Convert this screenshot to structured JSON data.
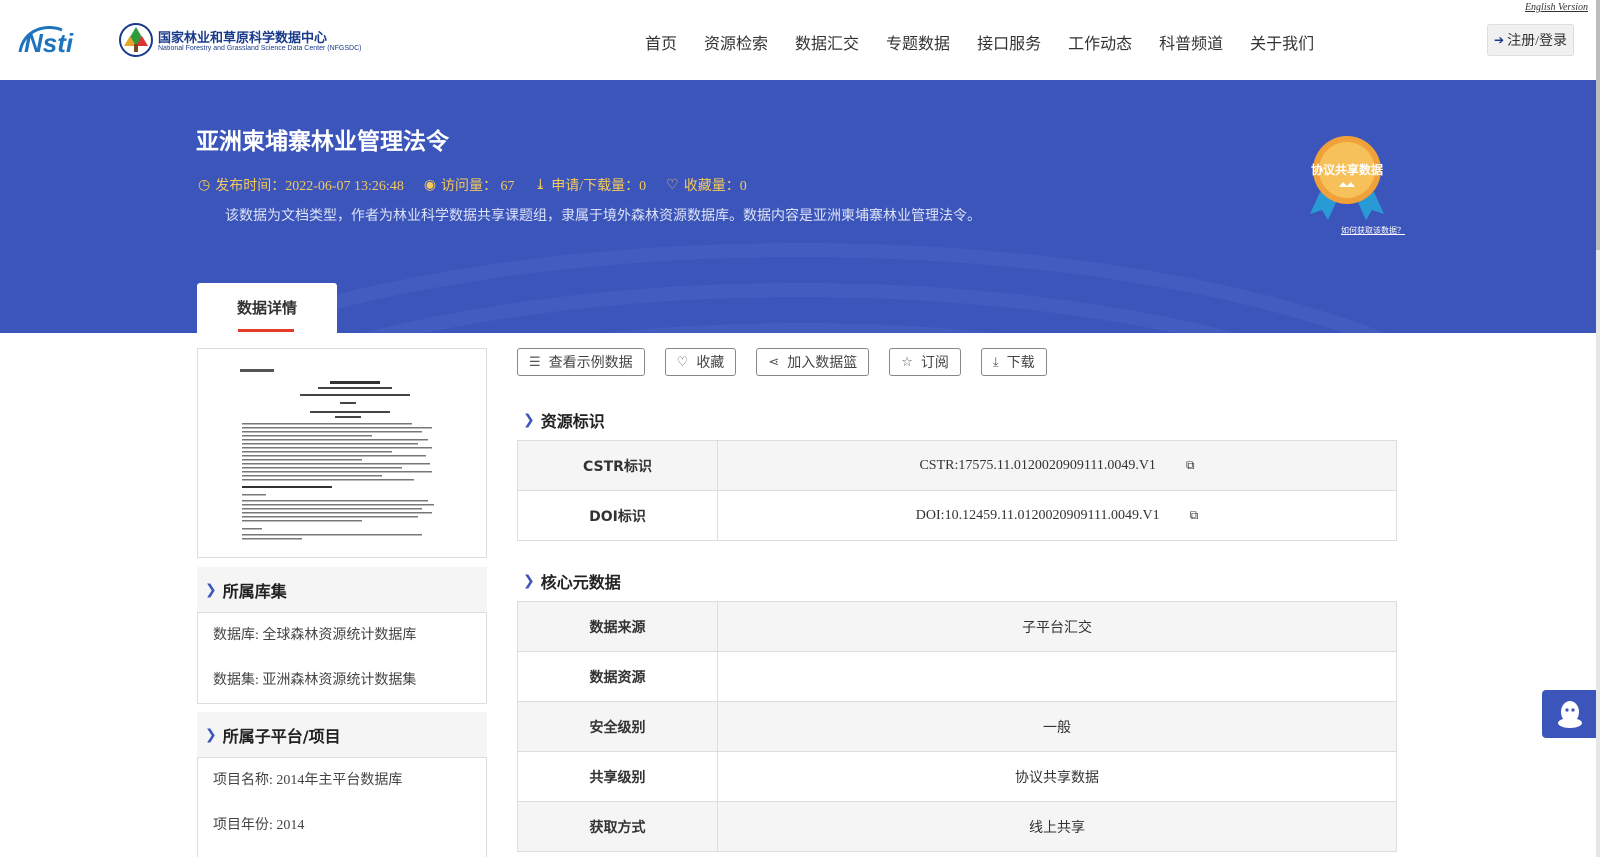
{
  "header": {
    "logo_left": "Nsti",
    "org_title": "国家林业和草原科学数据中心",
    "org_subtitle": "National Forestry and Grassland Science Data Center (NFGSDC)",
    "nav": [
      "首页",
      "资源检索",
      "数据汇交",
      "专题数据",
      "接口服务",
      "工作动态",
      "科普频道",
      "关于我们"
    ],
    "english_link": "English Version",
    "login_label": "注册/登录"
  },
  "banner": {
    "title": "亚洲柬埔寨林业管理法令",
    "meta": {
      "publish": "发布时间：2022-06-07 13:26:48",
      "views": "访问量： 67",
      "downloads": "申请/下载量：0",
      "favorites": "收藏量：0"
    },
    "description": "该数据为文档类型，作者为林业科学数据共享课题组，隶属于境外森林资源数据库。数据内容是亚洲柬埔寨林业管理法令。",
    "badge_text": "协议共享数据",
    "badge_link": "如何获取该数据？",
    "tab_label": "数据详情"
  },
  "left": {
    "collection_head": "所属库集",
    "collection_items": [
      "数据库: 全球森林资源统计数据库",
      "数据集: 亚洲森林资源统计数据集"
    ],
    "platform_head": "所属子平台/项目",
    "platform_items": [
      "项目名称: 2014年主平台数据库",
      "项目年份: 2014"
    ]
  },
  "actions": [
    "查看示例数据",
    "收藏",
    "加入数据篮",
    "订阅",
    "下载"
  ],
  "identifiers": {
    "head": "资源标识",
    "rows": [
      {
        "key": "CSTR标识",
        "value": "CSTR:17575.11.0120020909111.0049.V1"
      },
      {
        "key": "DOI标识",
        "value": "DOI:10.12459.11.0120020909111.0049.V1"
      }
    ]
  },
  "core": {
    "head": "核心元数据",
    "rows": [
      {
        "key": "数据来源",
        "value": "子平台汇交"
      },
      {
        "key": "数据资源",
        "value": ""
      },
      {
        "key": "安全级别",
        "value": "一般"
      },
      {
        "key": "共享级别",
        "value": "协议共享数据"
      },
      {
        "key": "获取方式",
        "value": "线上共享"
      }
    ]
  },
  "colors": {
    "banner": "#3b55bb",
    "accent": "#e23b2b",
    "meta": "#f4c95d"
  }
}
